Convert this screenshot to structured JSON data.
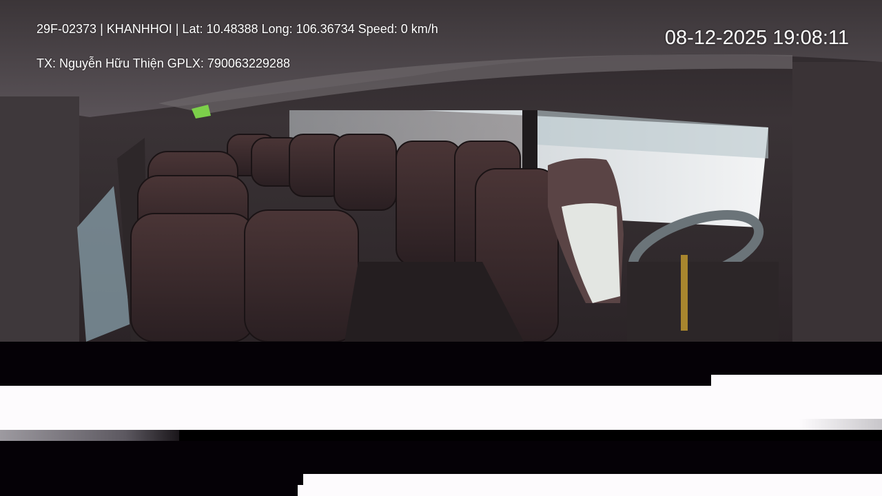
{
  "overlay": {
    "line1": "29F-02373 | KHANHHOI | Lat: 10.48388 Long: 106.36734 Speed: 0 km/h",
    "line2": "TX: Nguyễn Hữu Thiện GPLX: 790063229288",
    "timestamp": "08-12-2025 19:08:11"
  },
  "colors": {
    "overlay_text": "#ffffff",
    "glitch_black": "#050106",
    "glitch_white": "#fdfbfd"
  }
}
